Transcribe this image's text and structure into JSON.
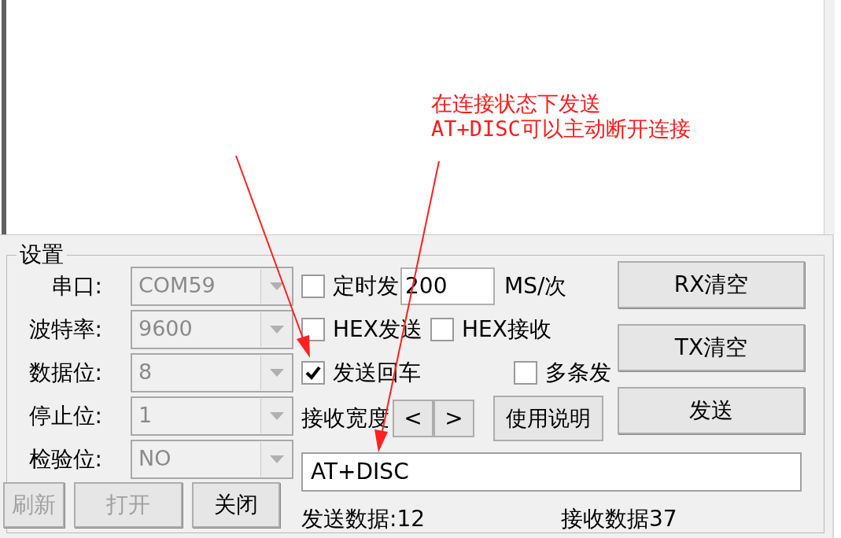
{
  "annotation": {
    "lines": [
      "在连接状态下发送",
      "AT+DISC可以主动断开连接"
    ]
  },
  "settings": {
    "title": "设置",
    "fields": [
      {
        "label": "串口:",
        "value": "COM59",
        "disabled": true
      },
      {
        "label": "波特率:",
        "value": "9600",
        "disabled": true
      },
      {
        "label": "数据位:",
        "value": "8",
        "disabled": true
      },
      {
        "label": "停止位:",
        "value": "1",
        "disabled": true
      },
      {
        "label": "检验位:",
        "value": "NO",
        "disabled": true
      }
    ],
    "port_buttons": [
      {
        "label": "刷新",
        "disabled": true
      },
      {
        "label": "打开",
        "disabled": true
      },
      {
        "label": "关闭",
        "disabled": false
      }
    ],
    "timed_send": {
      "label": "定时发",
      "checked": false,
      "interval": "200",
      "unit": "MS/次"
    },
    "hex_send": {
      "label": "HEX发送",
      "checked": false
    },
    "hex_receive": {
      "label": "HEX接收",
      "checked": false
    },
    "send_newline": {
      "label": "发送回车",
      "checked": true
    },
    "multi_send": {
      "label": "多条发",
      "checked": false
    },
    "receive_width": {
      "label": "接收宽度",
      "buttons": [
        "<",
        ">"
      ]
    },
    "help_button": "使用说明",
    "action_buttons": [
      "RX清空",
      "TX清空",
      "发送"
    ],
    "send_input": {
      "value": "AT+DISC"
    },
    "status": {
      "sent": "发送数据:12",
      "received": "接收数据37"
    }
  }
}
